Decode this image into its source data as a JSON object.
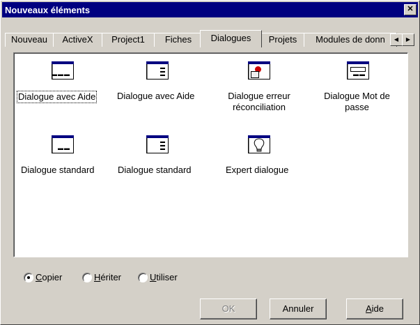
{
  "window": {
    "title": "Nouveaux éléments",
    "close_glyph": "✕"
  },
  "tabs": [
    {
      "label": "Nouveau"
    },
    {
      "label": "ActiveX"
    },
    {
      "label": "Project1"
    },
    {
      "label": "Fiches"
    },
    {
      "label": "Dialogues",
      "active": true
    },
    {
      "label": "Projets"
    },
    {
      "label": "Modules de donn"
    }
  ],
  "tab_scroll": {
    "left_glyph": "◀",
    "right_glyph": "▶"
  },
  "items": [
    {
      "label": "Dialogue avec Aide",
      "icon": "dialog-help-icon"
    },
    {
      "label": "Dialogue avec Aide",
      "icon": "dialog-help-vertical-icon"
    },
    {
      "label": "Dialogue erreur réconciliation",
      "label_line1": "Dialogue erreur",
      "label_line2": "réconciliation",
      "icon": "dialog-error-icon"
    },
    {
      "label": "Dialogue Mot de passe",
      "label_line1": "Dialogue Mot de",
      "label_line2": "passe",
      "icon": "password-dialog-icon"
    },
    {
      "label": "Dialogue standard",
      "icon": "dialog-standard-icon"
    },
    {
      "label": "Dialogue standard",
      "icon": "dialog-standard-vertical-icon"
    },
    {
      "label": "Expert dialogue",
      "icon": "lightbulb-icon"
    }
  ],
  "options": {
    "copy": {
      "label_u": "C",
      "label_rest": "opier",
      "checked": true
    },
    "inherit": {
      "label_u": "H",
      "label_rest": "ériter",
      "checked": false
    },
    "use": {
      "label_u": "U",
      "label_rest": "tiliser",
      "checked": false
    }
  },
  "buttons": {
    "ok": "OK",
    "cancel": "Annuler",
    "help_u": "A",
    "help_rest": "ide"
  }
}
